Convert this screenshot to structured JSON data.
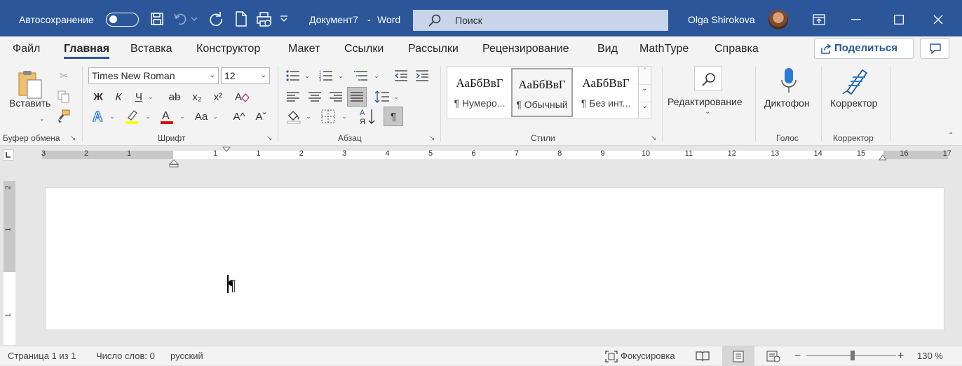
{
  "titlebar": {
    "autosave_label": "Автосохранение",
    "doc_title": "Документ7",
    "title_sep": "-",
    "app_name": "Word",
    "search_placeholder": "Поиск",
    "user_name": "Olga Shirokova"
  },
  "tabs": [
    "Файл",
    "Главная",
    "Вставка",
    "Конструктор",
    "Макет",
    "Ссылки",
    "Рассылки",
    "Рецензирование",
    "Вид",
    "MathType",
    "Справка"
  ],
  "active_tab": "Главная",
  "share_label": "Поделиться",
  "ribbon": {
    "clipboard": {
      "paste_label": "Вставить",
      "group_label": "Буфер обмена"
    },
    "font": {
      "font_name": "Times New Roman",
      "font_size": "12",
      "bold": "Ж",
      "italic": "К",
      "underline": "Ч",
      "strike": "ab",
      "subscript": "x₂",
      "superscript": "x²",
      "case": "Aa",
      "grow": "A^",
      "shrink": "Aˇ",
      "group_label": "Шрифт"
    },
    "paragraph": {
      "group_label": "Абзац",
      "pilcrow": "¶"
    },
    "styles": {
      "sample": "АаБбВвГ",
      "items": [
        "¶ Нумеро...",
        "¶ Обычный",
        "¶ Без инт..."
      ],
      "group_label": "Стили"
    },
    "editing": {
      "label": "Редактирование"
    },
    "voice": {
      "label": "Диктофон",
      "group_label": "Голос"
    },
    "editor": {
      "label": "Корректор",
      "group_label": "Корректор"
    }
  },
  "ruler_numbers": [
    "3",
    "2",
    "1",
    "1",
    "1",
    "2",
    "3",
    "4",
    "5",
    "6",
    "7",
    "8",
    "9",
    "10",
    "11",
    "12",
    "13",
    "14",
    "15",
    "16",
    "17"
  ],
  "ruler_marks": [
    3,
    2,
    1,
    1,
    1,
    2,
    3,
    4,
    5,
    6,
    7,
    8,
    9,
    10,
    11,
    12,
    13,
    14,
    15,
    16,
    17
  ],
  "document": {
    "pilcrow": "¶"
  },
  "status": {
    "page": "Страница 1 из 1",
    "words": "Число слов: 0",
    "language": "русский",
    "focus": "Фокусировка",
    "zoom": "130 %",
    "zoom_percent": 130
  },
  "colors": {
    "accent": "#2b579a",
    "highlight": "#ffff00",
    "font_color": "#e00000"
  }
}
